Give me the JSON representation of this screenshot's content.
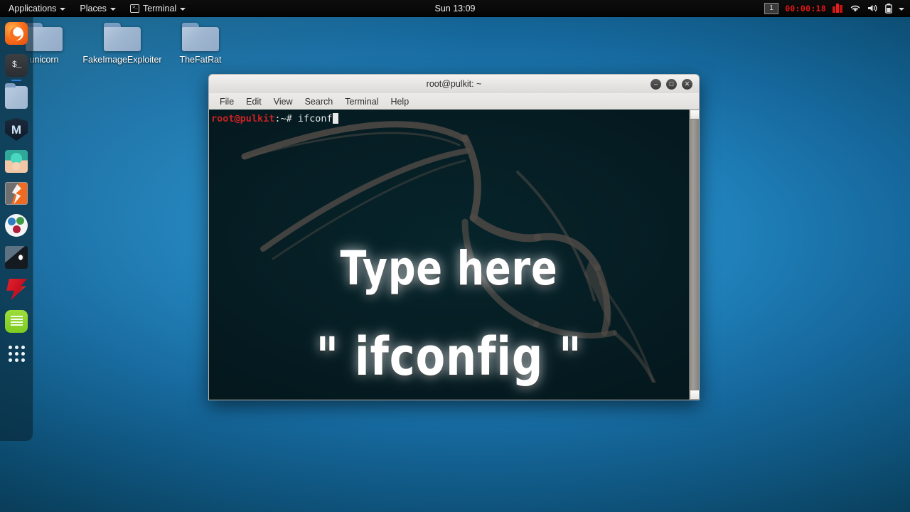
{
  "top_panel": {
    "applications_label": "Applications",
    "places_label": "Places",
    "terminal_label": "Terminal",
    "terminal_icon": "terminal-icon",
    "clock": "Sun 13:09",
    "workspace": "1",
    "rec_timer": "00:00:18",
    "rec_icon": "record-icon",
    "wifi_icon": "wifi-icon",
    "volume_icon": "volume-icon",
    "battery_icon": "battery-icon",
    "menu_caret": "chevron-down-icon"
  },
  "desktop_icons": [
    {
      "label": "unicorn",
      "icon": "folder-icon"
    },
    {
      "label": "FakeImageExploiter",
      "icon": "folder-icon"
    },
    {
      "label": "TheFatRat",
      "icon": "folder-icon"
    }
  ],
  "dock": {
    "items": [
      {
        "name": "firefox",
        "label": "Firefox",
        "running": false
      },
      {
        "name": "terminal",
        "label": "Terminal",
        "running": true
      },
      {
        "name": "files",
        "label": "Files",
        "running": false
      },
      {
        "name": "metasploit",
        "label": "Metasploit Framework",
        "running": false
      },
      {
        "name": "armitage",
        "label": "Armitage",
        "running": false
      },
      {
        "name": "burpsuite",
        "label": "Burp Suite",
        "running": false
      },
      {
        "name": "beef",
        "label": "BeEF",
        "running": false
      },
      {
        "name": "wireshark",
        "label": "Wireshark",
        "running": false
      },
      {
        "name": "faraday",
        "label": "Faraday IDE",
        "running": false
      },
      {
        "name": "text-editor",
        "label": "Text Editor",
        "running": false
      }
    ],
    "show_applications_label": "Show Applications"
  },
  "terminal": {
    "title": "root@pulkit: ~",
    "menu": [
      "File",
      "Edit",
      "View",
      "Search",
      "Terminal",
      "Help"
    ],
    "window_buttons": {
      "minimize": "–",
      "maximize": "□",
      "close": "✕"
    },
    "prompt": {
      "user_host": "root@pulkit",
      "path_sigil": ":~# ",
      "command": "ifconf",
      "cursor": "block-cursor"
    },
    "overlay": {
      "line1": "Type here",
      "line2": "\" ifconfig \""
    },
    "background_watermark": "kali-dragon-logo",
    "scrollbar": "vertical-scrollbar"
  },
  "colors": {
    "desktop_accent": "#2f9ad4",
    "terminal_bg": "#04191e",
    "prompt_red": "#cc2222",
    "timer_red": "#e21616",
    "dock_bg": "#0a2634"
  }
}
